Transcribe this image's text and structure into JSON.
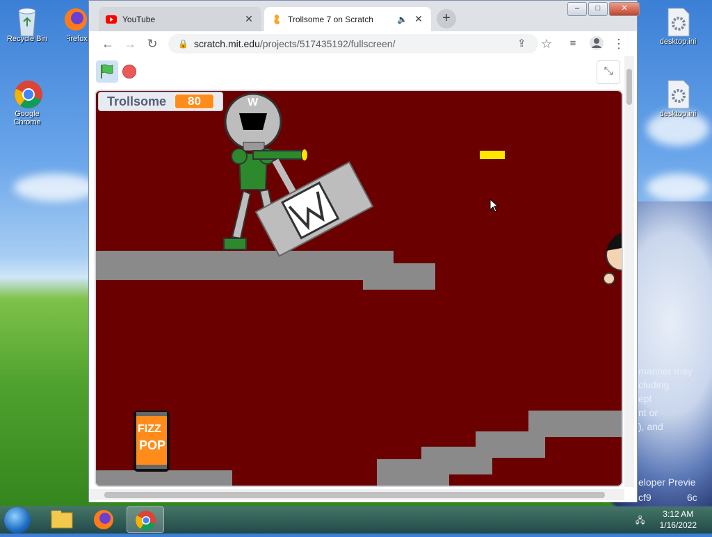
{
  "desktop": {
    "icons": [
      {
        "label": "Recycle Bin",
        "icon": "recycle-bin-icon"
      },
      {
        "label": "Firefox",
        "icon": "firefox-icon"
      },
      {
        "label": "Google Chrome",
        "icon": "chrome-icon"
      },
      {
        "label": "desktop.ini",
        "icon": "settings-file-icon"
      },
      {
        "label": "desktop.ini",
        "icon": "settings-file-icon"
      }
    ],
    "wallpaper_text": [
      "manner may",
      "cluding",
      "ept",
      "nt or",
      "), and",
      "eloper Previe",
      "cf9",
      "6c"
    ]
  },
  "browser": {
    "tabs": [
      {
        "title": "YouTube",
        "icon": "youtube-icon",
        "active": false
      },
      {
        "title": "Trollsome 7 on Scratch",
        "icon": "scratch-icon",
        "active": true,
        "audio": "speaker-icon"
      }
    ],
    "new_tab": "+",
    "url_host": "scratch.mit.edu",
    "url_path": "/projects/517435192/fullscreen/"
  },
  "scratch": {
    "variable_label": "Trollsome",
    "variable_value": "80",
    "sprites": {
      "can_line1": "FIZZ",
      "can_line2": "POP",
      "robot_head_letter": "W",
      "sign_letter": "W"
    }
  },
  "taskbar": {
    "time": "3:12 AM",
    "date": "1/16/2022",
    "apps": [
      "explorer-icon",
      "firefox-icon",
      "chrome-icon"
    ]
  }
}
